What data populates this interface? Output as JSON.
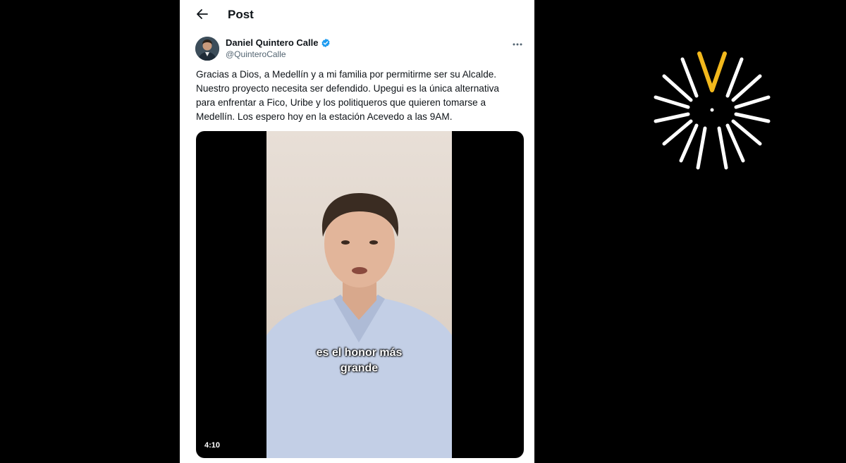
{
  "header": {
    "title": "Post",
    "back_icon": "arrow-left-icon"
  },
  "author": {
    "name": "Daniel Quintero Calle",
    "handle": "@QuinteroCalle",
    "verified": true,
    "verified_color": "#1d9bf0"
  },
  "post": {
    "text": "Gracias a Dios, a Medellín y a mi familia por permitirme ser su Alcalde.\nNuestro proyecto necesita ser defendido. Upegui es la única alternativa\npara enfrentar a Fico, Uribe y los politiqueros que quieren tomarse a\nMedellín. Los espero hoy en la estación Acevedo a las 9AM."
  },
  "video": {
    "subtitle_line1": "es el honor más",
    "subtitle_line2": "grande",
    "duration": "4:10"
  },
  "colors": {
    "brand_yellow": "#f2b81c",
    "brand_white": "#ffffff"
  }
}
